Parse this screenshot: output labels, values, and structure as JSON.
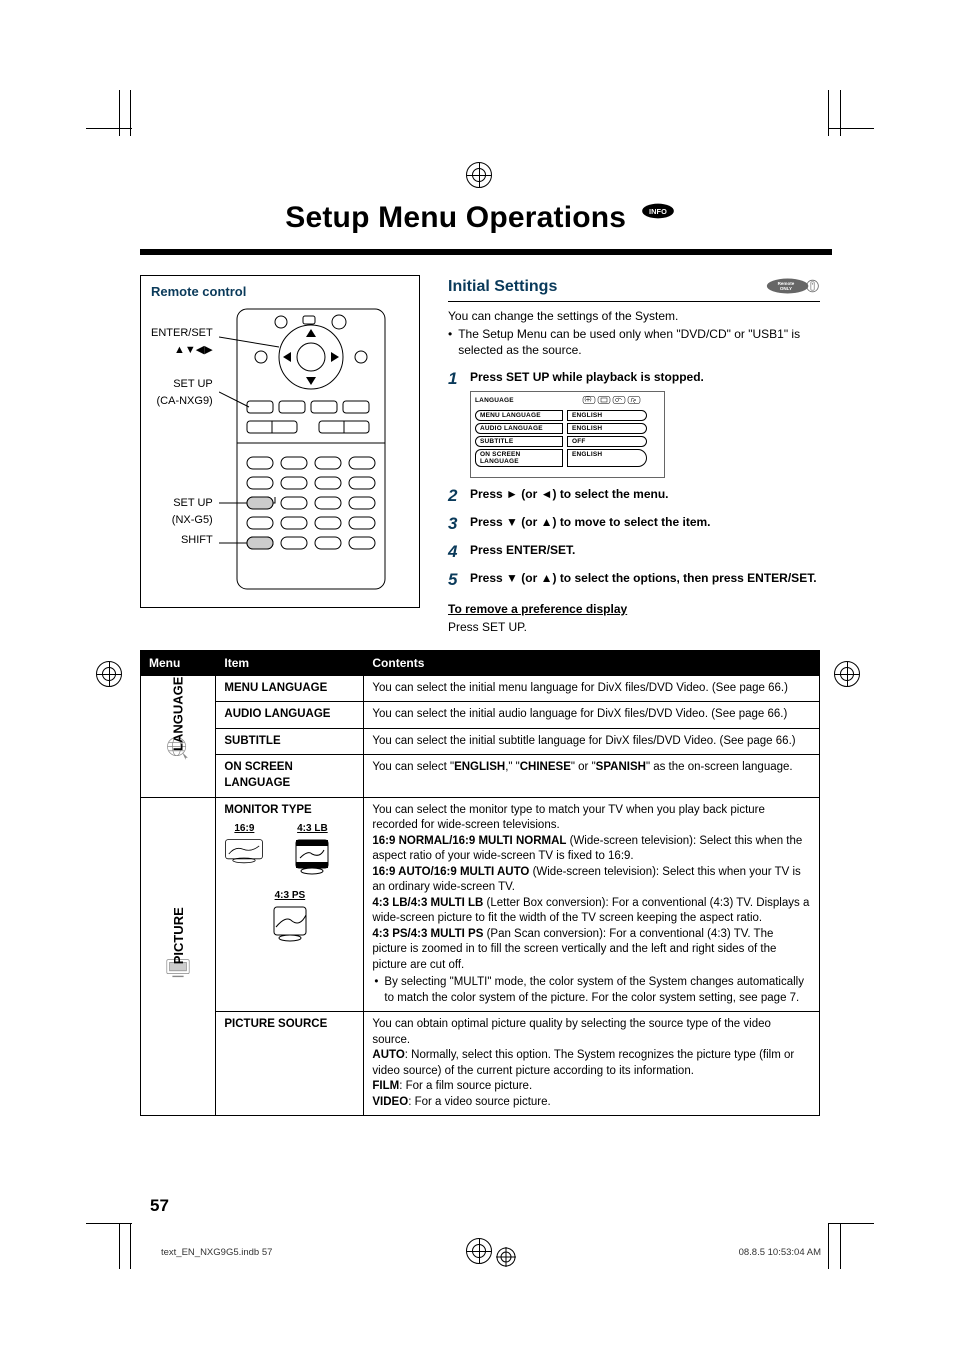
{
  "title": "Setup Menu Operations",
  "remote_control": {
    "heading": "Remote control",
    "labels": {
      "enter_set": "ENTER/SET",
      "arrows": "5∞2 3",
      "setup1": "SET UP",
      "setup1_sub": "(CA-NXG9)",
      "setup2": "SET UP",
      "setup2_sub": "(NX-G5)",
      "shift": "SHIFT"
    }
  },
  "initial_settings": {
    "heading": "Initial Settings",
    "intro": "You can change the settings of the System.",
    "bullet": "The Setup Menu can be used only when \"DVD/CD\" or \"USB1\" is selected as the source.",
    "steps": {
      "s1": "Press SET UP while playback is stopped.",
      "s2_pre": "Press ",
      "s2_mid": " (or ",
      "s2_post": ") to select the menu.",
      "s3_pre": "Press ",
      "s3_mid": " (or ",
      "s3_post": ") to move to select the item.",
      "s4": "Press ENTER/SET.",
      "s5_pre": "Press ",
      "s5_mid": " (or ",
      "s5_post": ") to select the options, then press ENTER/SET."
    },
    "osd": {
      "title": "LANGUAGE",
      "rows": [
        {
          "l": "MENU LANGUAGE",
          "r": "ENGLISH"
        },
        {
          "l": "AUDIO LANGUAGE",
          "r": "ENGLISH"
        },
        {
          "l": "SUBTITLE",
          "r": "OFF"
        },
        {
          "l": "ON SCREEN LANGUAGE",
          "r": "ENGLISH"
        }
      ]
    },
    "remove_heading": "To remove a preference display",
    "remove_text": "Press SET UP."
  },
  "table": {
    "headers": {
      "menu": "Menu",
      "item": "Item",
      "contents": "Contents"
    },
    "language_label": "LANGUAGE",
    "picture_label": "PICTURE",
    "rows": {
      "menu_language": {
        "item": "MENU LANGUAGE",
        "content": "You can select the initial menu language for DivX files/DVD Video. (See page 66.)"
      },
      "audio_language": {
        "item": "AUDIO LANGUAGE",
        "content": "You can select the initial audio language for DivX files/DVD Video. (See page 66.)"
      },
      "subtitle": {
        "item": "SUBTITLE",
        "content": "You can select the initial subtitle language for DivX files/DVD Video. (See page 66.)"
      },
      "on_screen_language": {
        "item": "ON SCREEN LANGUAGE",
        "content_pre": "You can select \"",
        "opt1": "ENGLISH",
        "sep1": ",\" \"",
        "opt2": "CHINESE",
        "sep2": "\"  or \"",
        "opt3": "SPANISH",
        "content_post": "\" as the on-screen language."
      },
      "monitor_type": {
        "item": "MONITOR TYPE",
        "labels": {
          "a": "16:9",
          "b": "4:3 LB",
          "c": "4:3 PS"
        },
        "intro": "You can select the monitor type to match your TV when you play back picture recorded for wide-screen televisions.",
        "l1_b": "16:9 NORMAL/16:9 MULTI NORMAL",
        "l1": " (Wide-screen television): Select this when the aspect ratio of your wide-screen TV is fixed to 16:9.",
        "l2_b": "16:9 AUTO/16:9 MULTI AUTO",
        "l2": " (Wide-screen television): Select this when your TV is an ordinary wide-screen TV.",
        "l3_b": "4:3 LB/4:3 MULTI LB",
        "l3": " (Letter Box conversion): For a conventional (4:3) TV. Displays a wide-screen picture to fit the width of the TV screen keeping the aspect ratio.",
        "l4_b": "4:3 PS/4:3 MULTI PS",
        "l4": " (Pan Scan conversion): For a conventional (4:3) TV. The picture is zoomed in to fill the screen vertically and the left and right sides of the picture are cut off.",
        "bullet": "By selecting \"MULTI\" mode, the color system of the System changes automatically to match the color system of the picture. For the color system setting, see page 7."
      },
      "picture_source": {
        "item": "PICTURE SOURCE",
        "intro": "You can obtain optimal picture quality by selecting the source type of the video source.",
        "l1_b": "AUTO",
        "l1": ": Normally, select this option. The System recognizes the picture type (film or video source) of the current picture according to its information.",
        "l2_b": "FILM",
        "l2": ": For a film source picture.",
        "l3_b": "VIDEO",
        "l3": ": For a video source picture."
      }
    }
  },
  "page_number": "57",
  "footer_left": "text_EN_NXG9G5.indb   57",
  "footer_right": "08.8.5   10:53:04 AM"
}
